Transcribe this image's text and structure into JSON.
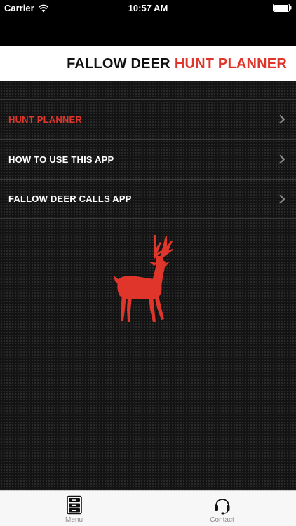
{
  "status_bar": {
    "carrier": "Carrier",
    "time": "10:57 AM"
  },
  "title": {
    "main": "FALLOW DEER",
    "accent": "HUNT PLANNER"
  },
  "menu": {
    "items": [
      {
        "label": "HUNT PLANNER",
        "active": true
      },
      {
        "label": "HOW TO USE THIS APP",
        "active": false
      },
      {
        "label": "FALLOW DEER CALLS APP",
        "active": false
      }
    ]
  },
  "tabs": [
    {
      "label": "Menu",
      "icon": "file-cabinet-icon"
    },
    {
      "label": "Contact",
      "icon": "headset-icon"
    }
  ],
  "colors": {
    "accent": "#e0352b",
    "background": "#141414",
    "banner": "#ffffff"
  }
}
